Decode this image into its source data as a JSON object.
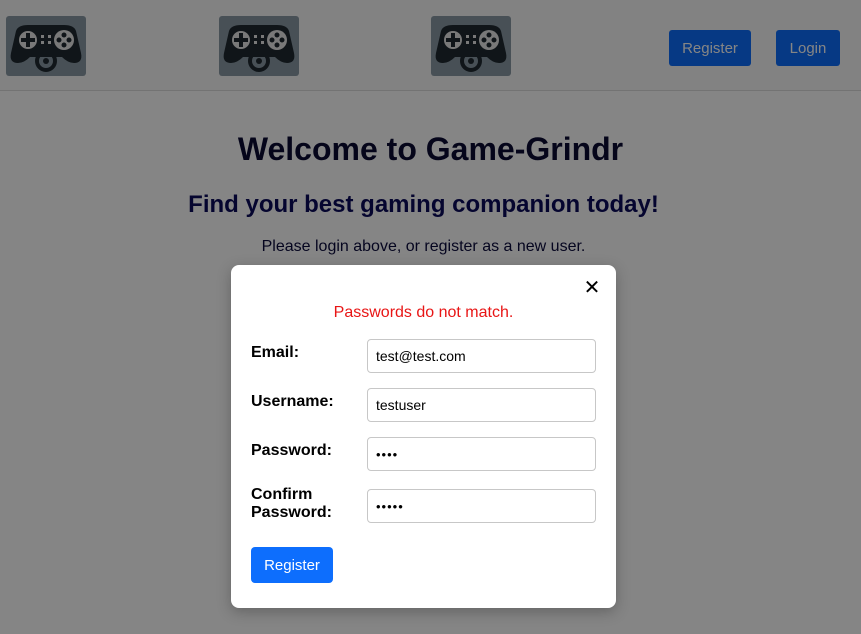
{
  "header": {
    "logo_icon": "gamepad-icon",
    "register_label": "Register",
    "login_label": "Login",
    "accent_color": "#0d6efd"
  },
  "main": {
    "title": "Welcome to Game-Grindr",
    "subtitle": "Find your best gaming companion today!",
    "instructions": "Please login above, or register as a new user."
  },
  "modal": {
    "close_symbol": "✕",
    "error_message": "Passwords do not match.",
    "error_color": "#e81515",
    "fields": {
      "email": {
        "label": "Email:",
        "value": "test@test.com"
      },
      "username": {
        "label": "Username:",
        "value": "testuser"
      },
      "password": {
        "label": "Password:",
        "value": "••••"
      },
      "confirm_password": {
        "label_line1": "Confirm",
        "label_line2": "Password:",
        "value": "•••••"
      }
    },
    "register_label": "Register"
  }
}
